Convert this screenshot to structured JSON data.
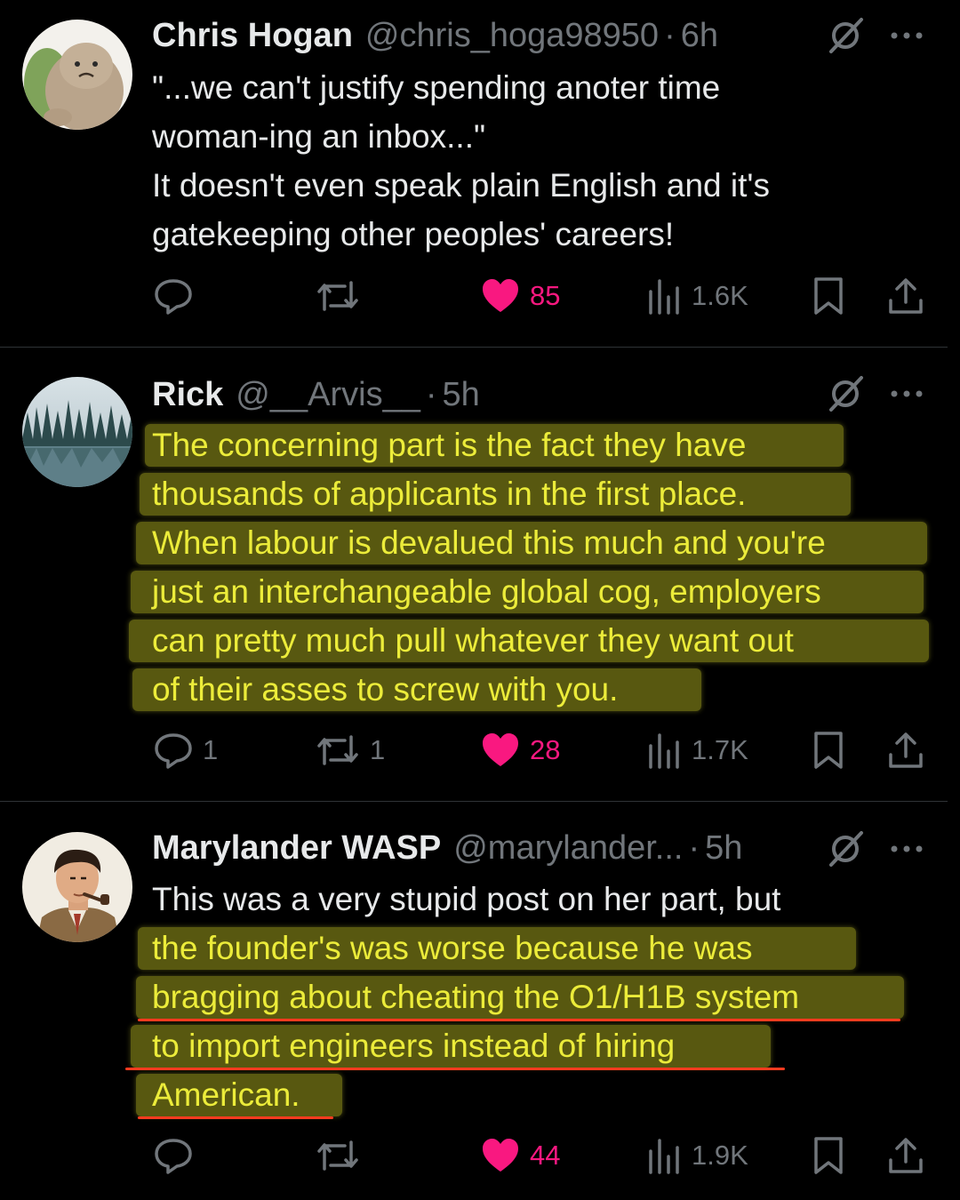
{
  "tweets": [
    {
      "name": "Chris Hogan",
      "handle": "@chris_hoga98950",
      "time": "6h",
      "lines": [
        "\"...we can't justify spending anoter time",
        "woman-ing an inbox...\"",
        "It doesn't even speak plain English and it's",
        "gatekeeping other peoples' careers!"
      ],
      "replies": "",
      "reposts": "",
      "likes": "85",
      "views": "1.6K"
    },
    {
      "name": "Rick",
      "handle": "@__Arvis__",
      "time": "5h",
      "lines": [
        "The concerning part is the fact they have",
        "thousands of applicants in the first place.",
        "When labour is devalued this much and you're",
        "just an interchangeable global cog, employers",
        "can pretty much pull whatever they want out",
        "of their asses to screw with you."
      ],
      "replies": "1",
      "reposts": "1",
      "likes": "28",
      "views": "1.7K"
    },
    {
      "name": "Marylander WASP",
      "handle": "@marylander...",
      "time": "5h",
      "lines": [
        "This was a very stupid post on her part, but",
        "the founder's was worse because he was",
        "bragging about cheating the O1/H1B system",
        "to import engineers instead of hiring",
        "American."
      ],
      "replies": "",
      "reposts": "",
      "likes": "44",
      "views": "1.9K"
    }
  ],
  "separator": "·",
  "icons": {
    "reply": "reply-icon",
    "repost": "repost-icon",
    "like": "heart-icon",
    "views": "views-icon",
    "bookmark": "bookmark-icon",
    "share": "share-icon",
    "grok": "grok-icon",
    "more": "more-icon"
  },
  "colors": {
    "background": "#000000",
    "text": "#e7e9ea",
    "muted": "#71767b",
    "like": "#f91880",
    "highlight": "#a0a01e",
    "highlight_text": "#ecec3a",
    "underline": "#ff3b1f"
  }
}
